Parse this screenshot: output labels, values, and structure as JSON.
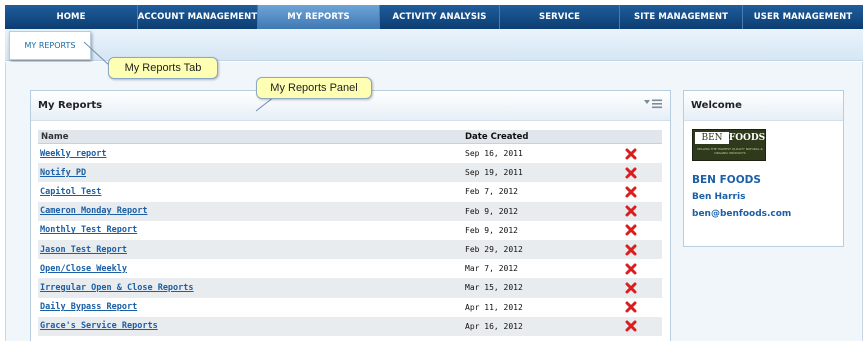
{
  "nav": {
    "items": [
      {
        "label": "HOME",
        "active": false
      },
      {
        "label": "ACCOUNT MANAGEMENT",
        "active": false
      },
      {
        "label": "MY REPORTS",
        "active": true
      },
      {
        "label": "ACTIVITY ANALYSIS",
        "active": false
      },
      {
        "label": "SERVICE",
        "active": false
      },
      {
        "label": "SITE MANAGEMENT",
        "active": false
      },
      {
        "label": "USER MANAGEMENT",
        "active": false
      }
    ]
  },
  "subnav": {
    "tab_label": "MY REPORTS"
  },
  "callouts": {
    "tab": "My Reports Tab",
    "panel": "My Reports Panel"
  },
  "reports_panel": {
    "title": "My Reports",
    "columns": {
      "name": "Name",
      "date": "Date Created"
    },
    "rows": [
      {
        "name": "Weekly report",
        "date": "Sep 16, 2011"
      },
      {
        "name": "Notify PD",
        "date": "Sep 19, 2011"
      },
      {
        "name": "Capitol Test",
        "date": "Feb 7, 2012"
      },
      {
        "name": "Cameron Monday Report",
        "date": "Feb 9, 2012"
      },
      {
        "name": "Monthly Test Report",
        "date": "Feb 9, 2012"
      },
      {
        "name": "Jason Test Report",
        "date": "Feb 29, 2012"
      },
      {
        "name": "Open/Close Weekly",
        "date": "Mar 7, 2012"
      },
      {
        "name": "Irregular Open & Close Reports",
        "date": "Mar 15, 2012"
      },
      {
        "name": "Daily Bypass Report",
        "date": "Apr 11, 2012"
      },
      {
        "name": "Grace's Service Reports",
        "date": "Apr 16, 2012"
      }
    ]
  },
  "welcome_panel": {
    "title": "Welcome",
    "logo": {
      "left": "BEN",
      "right": "FOODS",
      "tagline": "SELLING THE HIGHEST QUALITY NATURAL & ORGANIC PRODUCTS"
    },
    "company": "BEN FOODS",
    "user_name": "Ben Harris",
    "email": "ben@benfoods.com"
  },
  "colors": {
    "nav_bg": "#0c3d72",
    "nav_active": "#5b92c9",
    "link": "#1b5fa6",
    "delete": "#d81e1e",
    "callout_bg": "#ffffb3"
  }
}
